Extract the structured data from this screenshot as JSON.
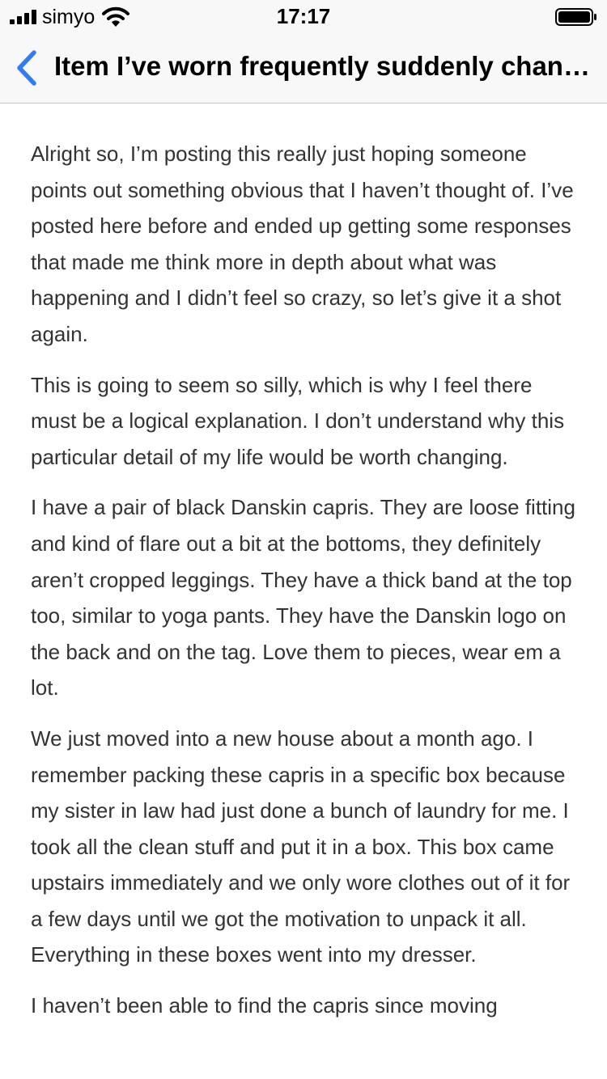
{
  "status_bar": {
    "carrier": "simyo",
    "time": "17:17"
  },
  "nav": {
    "back_icon": "chevron-left-icon",
    "title": "Item I’ve worn frequently suddenly changed"
  },
  "colors": {
    "accent": "#2f7cf6",
    "text": "#333333",
    "bar_background": "#f8f8f8"
  },
  "post": {
    "paragraphs": [
      "Alright so, I’m posting this really just hoping someone points out something obvious that I haven’t thought of. I’ve posted here before and ended up getting some responses that made me think more in depth about what was happening and I didn’t feel so crazy, so let’s give it a shot again.",
      "This is going to seem so silly, which is why I feel there must be a logical explanation. I don’t understand why this particular detail of my life would be worth changing.",
      "I have a pair of black Danskin capris. They are loose fitting and kind of flare out a bit at the bottoms, they definitely aren’t cropped leggings. They have a thick band at the top too, similar to yoga pants. They have the Danskin logo on the back and on the tag. Love them to pieces, wear em a lot.",
      "We just moved into a new house about a month ago. I remember packing these capris in a specific box because my sister in law had just done a bunch of laundry for me. I took all the clean stuff and put it in a box. This box came upstairs immediately and we only wore clothes out of it for a few days until we got the motivation to unpack it all. Everything in these boxes went into my dresser.",
      "I haven’t been able to find the capris since moving"
    ]
  }
}
